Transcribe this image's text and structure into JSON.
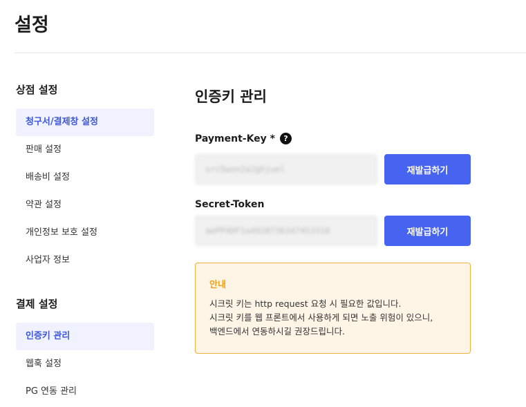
{
  "page": {
    "title": "설정"
  },
  "sidebar": {
    "sections": [
      {
        "title": "상점 설정",
        "items": [
          "청구서/결제창 설정",
          "판매 설정",
          "배송비 설정",
          "약관 설정",
          "개인정보 보호 설정",
          "사업자 정보"
        ]
      },
      {
        "title": "결제 설정",
        "items": [
          "인증키 관리",
          "웹훅 설정",
          "PG 연동 관리"
        ]
      }
    ],
    "selected": [
      "청구서/결제창 설정",
      "인증키 관리"
    ]
  },
  "main": {
    "title": "인증키 관리",
    "payment_key": {
      "label": "Payment-Key *",
      "help_icon": "?",
      "value": "src5won2a2ghjuel",
      "button_label": "재발급하기"
    },
    "secret_token": {
      "label": "Secret-Token",
      "value": "aePP4DF1a4920736347453310",
      "button_label": "재발급하기"
    },
    "notice": {
      "title": "안내",
      "lines": [
        "시크릿 키는 http request 요청 시 필요한 값입니다.",
        "시크릿 키를 웹 프론트에서 사용하게 되면 노출 위험이 있으니,",
        "백엔드에서 연동하시길 권장드립니다."
      ]
    }
  },
  "colors": {
    "accent": "#4764f0",
    "active_bg": "#f0f2ff",
    "notice_bg": "#fff5e7",
    "notice_border": "#f5b13d",
    "notice_title": "#f0a11e"
  }
}
